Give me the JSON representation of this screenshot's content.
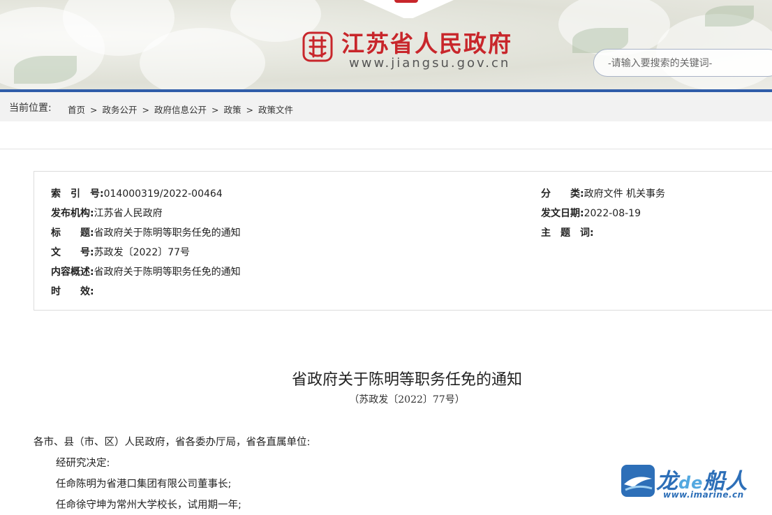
{
  "header": {
    "site_title": "江苏省人民政府",
    "site_url": "www.jiangsu.gov.cn",
    "search_placeholder": "-请输入要搜索的关键词-",
    "accent_red": "#c8262b",
    "accent_blue": "#2f5da9"
  },
  "breadcrumb": {
    "label": "当前位置:",
    "items": [
      "首页",
      "政务公开",
      "政府信息公开",
      "政策",
      "政策文件"
    ],
    "separator": ">"
  },
  "meta": {
    "index_label": "索　引　号:",
    "index_value": "014000319/2022-00464",
    "publisher_label": "发布机构:",
    "publisher_value": "江苏省人民政府",
    "title_label": "标　　题:",
    "title_value": "省政府关于陈明等职务任免的通知",
    "docno_label": "文　　号:",
    "docno_value": "苏政发〔2022〕77号",
    "summary_label": "内容概述:",
    "summary_value": "省政府关于陈明等职务任免的通知",
    "validity_label": "时　　效:",
    "category_label": "分　　类:",
    "category_value": "政府文件 机关事务",
    "date_label": "发文日期:",
    "date_value": "2022-08-19",
    "subject_label": "主　题　词:"
  },
  "document": {
    "title": "省政府关于陈明等职务任免的通知",
    "subtitle": "（苏政发〔2022〕77号）",
    "addressee": "各市、县（市、区）人民政府，省各委办厅局，省各直属单位:",
    "lines": [
      "经研究决定:",
      "任命陈明为省港口集团有限公司董事长;",
      "任命徐守坤为常州大学校长，试用期一年;"
    ]
  },
  "watermark": {
    "brand_a": "龙",
    "brand_de": "de",
    "brand_b": "船人",
    "url": "www.imarine.cn"
  }
}
